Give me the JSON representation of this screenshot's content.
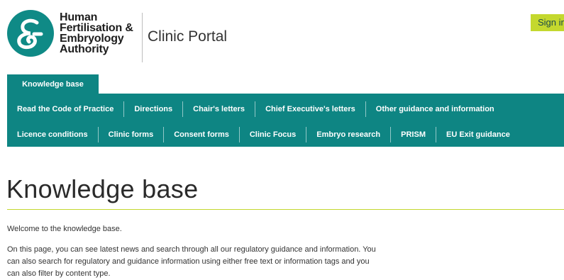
{
  "header": {
    "logo_lines": [
      "Human",
      "Fertilisation &",
      "Embryology",
      "Authority"
    ],
    "portal_title": "Clinic Portal",
    "signin_label": "Sign in"
  },
  "tab": {
    "label": "Knowledge base"
  },
  "nav": {
    "row1": [
      "Read the Code of Practice",
      "Directions",
      "Chair's letters",
      "Chief Executive's letters",
      "Other guidance and information"
    ],
    "row2": [
      "Licence conditions",
      "Clinic forms",
      "Consent forms",
      "Clinic Focus",
      "Embryo research",
      "PRISM",
      "EU Exit guidance"
    ]
  },
  "main": {
    "title": "Knowledge base",
    "intro": "Welcome to the knowledge base.",
    "body": "On this page, you can see latest news and search through all our regulatory guidance and information. You can also search for regulatory and guidance information using either free text or information tags and you can also filter by content type."
  },
  "colors": {
    "teal": "#0e8583",
    "lime": "#c4d82e"
  },
  "icons": {
    "logo": "hfea-logo-icon"
  }
}
